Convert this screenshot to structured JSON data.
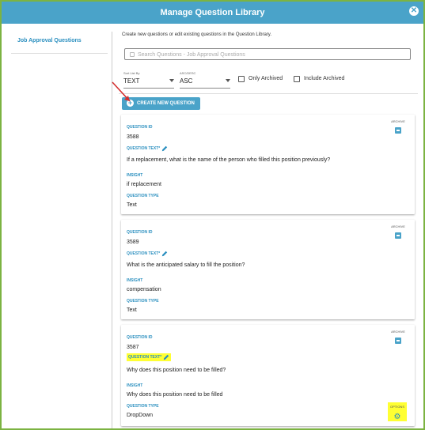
{
  "header": {
    "title": "Manage Question Library",
    "close_icon": "close-icon"
  },
  "sidebar": {
    "items": [
      {
        "label": "Job Approval Questions"
      }
    ]
  },
  "main": {
    "intro": "Create new questions or edit existing questions in the Question Library.",
    "search": {
      "placeholder": "Search Questions - Job Approval Questions"
    },
    "sort_list_by": {
      "label": "Sort List By",
      "value": "TEXT"
    },
    "order": {
      "label": "ASC/DESC",
      "value": "ASC"
    },
    "only_archived": {
      "label": "Only Archived",
      "checked": false
    },
    "include_archived": {
      "label": "Include Archived",
      "checked": false
    },
    "create_button": {
      "label": "CREATE NEW QUESTION"
    }
  },
  "labels": {
    "question_id": "QUESTION ID",
    "question_text": "QUESTION TEXT*",
    "insight": "INSIGHT",
    "question_type": "QUESTION TYPE",
    "archive": "ARCHIVE",
    "options": "OPTIONS"
  },
  "questions": [
    {
      "id": "3588",
      "text": "If a replacement, what is the name of the person who filled this position previously?",
      "insight": "if replacement",
      "type": "Text"
    },
    {
      "id": "3589",
      "text": "What is the anticipated salary to fill the position?",
      "insight": "compensation",
      "type": "Text"
    },
    {
      "id": "3587",
      "text": "Why does this position need to be filled?",
      "insight": "Why does this position need to be filled",
      "type": "DropDown"
    }
  ],
  "colors": {
    "accent": "#4aa3c9",
    "link": "#2a8fbf",
    "highlight": "#ffff33",
    "frame": "#7cb342",
    "arrow": "#d32f2f"
  }
}
